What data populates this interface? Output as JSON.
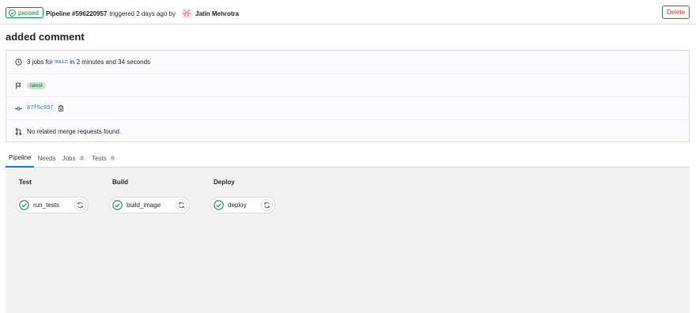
{
  "header": {
    "status": "passed",
    "pipeline_id": "Pipeline #596220957",
    "triggered": "triggered 2 days ago by",
    "author": "Jatin Mehrotra",
    "delete_label": "Delete"
  },
  "title": "added comment",
  "info": {
    "jobs_prefix": "3 jobs for",
    "branch": "main",
    "duration": "in 2 minutes and 34 seconds",
    "tag": "latest",
    "commit": "87f5c957",
    "merge_requests": "No related merge requests found."
  },
  "tabs": [
    {
      "label": "Pipeline",
      "count": null
    },
    {
      "label": "Needs",
      "count": null
    },
    {
      "label": "Jobs",
      "count": "3"
    },
    {
      "label": "Tests",
      "count": "0"
    }
  ],
  "stages": [
    {
      "name": "Test",
      "job": "run_tests"
    },
    {
      "name": "Build",
      "job": "build_image"
    },
    {
      "name": "Deploy",
      "job": "deploy"
    }
  ],
  "colors": {
    "success": "#108548",
    "danger": "#dd2b0e",
    "link": "#1f75cb"
  },
  "icons": [
    "check-circle-icon",
    "avatar-icon",
    "clock-icon",
    "flag-icon",
    "commit-icon",
    "copy-icon",
    "merge-request-icon",
    "retry-icon"
  ]
}
